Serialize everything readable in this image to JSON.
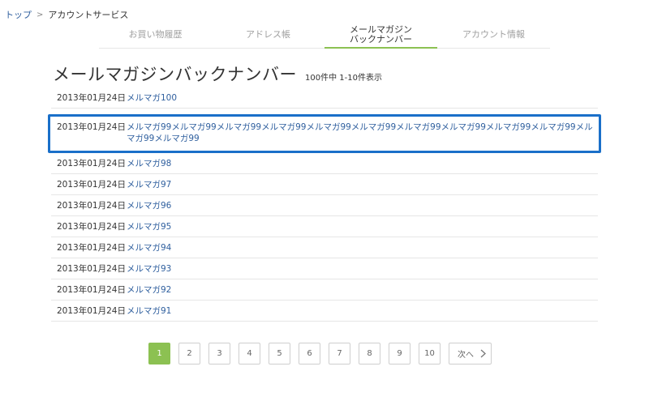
{
  "breadcrumb": {
    "home": "トップ",
    "current": "アカウントサービス"
  },
  "tabs": [
    {
      "label": "お買い物履歴"
    },
    {
      "label": "アドレス帳"
    },
    {
      "label": "メールマガジン\nバックナンバー"
    },
    {
      "label": "アカウント情報"
    }
  ],
  "page": {
    "title": "メールマガジンバックナンバー",
    "count_text": "100件中 1-10件表示"
  },
  "rows": [
    {
      "date": "2013年01月24日",
      "title": "メルマガ100"
    },
    {
      "date": "2013年01月24日",
      "title": "メルマガ99メルマガ99メルマガ99メルマガ99メルマガ99メルマガ99メルマガ99メルマガ99メルマガ99メルマガ99メルマガ99メルマガ99"
    },
    {
      "date": "2013年01月24日",
      "title": "メルマガ98"
    },
    {
      "date": "2013年01月24日",
      "title": "メルマガ97"
    },
    {
      "date": "2013年01月24日",
      "title": "メルマガ96"
    },
    {
      "date": "2013年01月24日",
      "title": "メルマガ95"
    },
    {
      "date": "2013年01月24日",
      "title": "メルマガ94"
    },
    {
      "date": "2013年01月24日",
      "title": "メルマガ93"
    },
    {
      "date": "2013年01月24日",
      "title": "メルマガ92"
    },
    {
      "date": "2013年01月24日",
      "title": "メルマガ91"
    }
  ],
  "pager": {
    "pages": [
      "1",
      "2",
      "3",
      "4",
      "5",
      "6",
      "7",
      "8",
      "9",
      "10"
    ],
    "current": "1",
    "next_label": "次へ",
    "next_icon": "chevron-right-icon"
  },
  "colors": {
    "accent": "#8cc152",
    "link": "#2f5f9e",
    "highlight": "#1a6fc9"
  }
}
